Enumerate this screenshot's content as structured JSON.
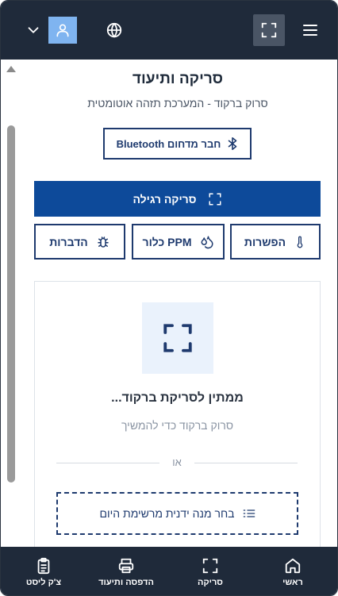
{
  "header": {
    "icons": [
      "chevron-down-icon",
      "user-icon",
      "globe-icon",
      "expand-icon",
      "menu-icon"
    ],
    "colors": {
      "background": "#1f2a3a",
      "user_button": "#7fb4f0",
      "expand_button": "#4a5565"
    }
  },
  "page": {
    "title": "סריקה ותיעוד",
    "subtitle": "סרוק ברקוד - המערכת תזהה אוטומטית"
  },
  "bluetooth": {
    "label": "חבר מדחום Bluetooth",
    "icon": "bluetooth-icon"
  },
  "scan": {
    "label": "סריקה רגילה",
    "icon": "scan-frame-icon",
    "color": "#0d4a9a"
  },
  "options": [
    {
      "label": "הפשרות",
      "icon": "thermometer-icon"
    },
    {
      "label": "PPM כלור",
      "icon": "droplets-icon"
    },
    {
      "label": "הדברות",
      "icon": "bug-icon"
    }
  ],
  "scanner": {
    "waiting": "ממתין לסריקת ברקוד...",
    "hint": "סרוק ברקוד כדי להמשיך",
    "or": "או",
    "manual_label": "בחר מנה ידנית מרשימת היום",
    "manual_icon": "list-icon"
  },
  "nav": [
    {
      "label": "ראשי",
      "icon": "home-icon"
    },
    {
      "label": "סריקה",
      "icon": "scan-frame-icon"
    },
    {
      "label": "הדפסה ותיעוד",
      "icon": "printer-icon"
    },
    {
      "label": "צ'ק ליסט",
      "icon": "clipboard-icon"
    }
  ],
  "accent_color": "#1e3a6e"
}
